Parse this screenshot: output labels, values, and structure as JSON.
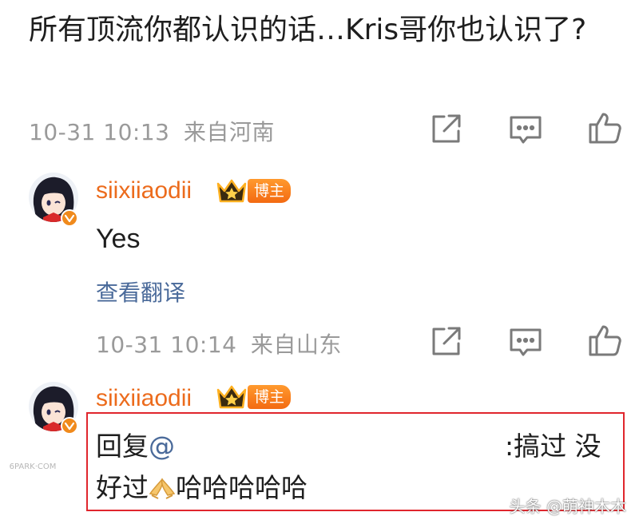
{
  "post": {
    "text": "所有顶流你都认识的话…Kris哥你也认识了?",
    "timestamp": "10-31 10:13",
    "location": "来自河南"
  },
  "comments": [
    {
      "username": "siixiiaodii",
      "role_badge": "博主",
      "text": "Yes",
      "translate_label": "查看翻译",
      "timestamp": "10-31 10:14",
      "location": "来自山东"
    },
    {
      "username": "siixiiaodii",
      "role_badge": "博主",
      "reply_prefix": "回复",
      "mention": "@",
      "reply_part1": ":搞过 没",
      "reply_part2": "好过",
      "reply_part3": "哈哈哈哈哈"
    }
  ],
  "icons": {
    "share": "share-icon",
    "comment": "comment-icon",
    "like": "thumbs-up-icon",
    "crown": "crown-icon",
    "verified": "verified-badge-icon",
    "emoji": "pray-hands-emoji-icon"
  },
  "watermarks": {
    "side": "6PARK·COM",
    "bottom": "头条 @萌神木木"
  },
  "colors": {
    "username": "#ec6b1c",
    "link": "#4a6a9a",
    "meta": "#9a9a9a",
    "highlight_border": "#e0262d",
    "badge": "#f36a12"
  }
}
